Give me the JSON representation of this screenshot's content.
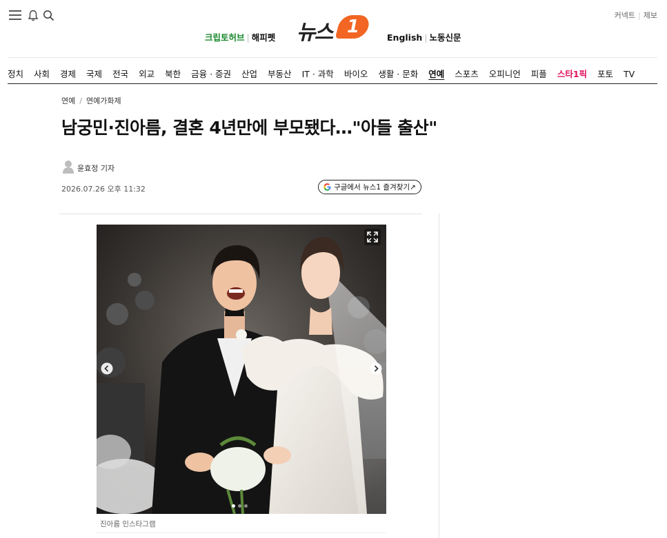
{
  "header": {
    "top_links": [
      "커넥트",
      "제보"
    ],
    "partners_left": [
      "크립토허브",
      "해피펫"
    ],
    "partners_right": [
      "English",
      "노동신문"
    ],
    "logo": {
      "text": "뉴스",
      "badge": "1"
    }
  },
  "nav": {
    "items": [
      "정치",
      "사회",
      "경제",
      "국제",
      "전국",
      "외교",
      "북한",
      "금융 · 증권",
      "산업",
      "부동산",
      "IT · 과학",
      "바이오",
      "생활 · 문화",
      "연예",
      "스포츠",
      "오피니언",
      "피플",
      "스타1픽",
      "포토",
      "TV"
    ],
    "active": "연예"
  },
  "article": {
    "breadcrumb": [
      "연예",
      "연예가화제"
    ],
    "title": "남궁민·진아름, 결혼 4년만에 부모됐다…\"아들 출산\"",
    "author": "윤효정 기자",
    "date": "2026.07.26 오후 11:32",
    "google_button": "구글에서 뉴스1 즐겨찾기↗",
    "photo_caption": "진아름 인스타그램"
  },
  "colors": {
    "brand": "#f26522",
    "partner_green": "#1a8a2e",
    "star_pink": "#e0115f"
  }
}
